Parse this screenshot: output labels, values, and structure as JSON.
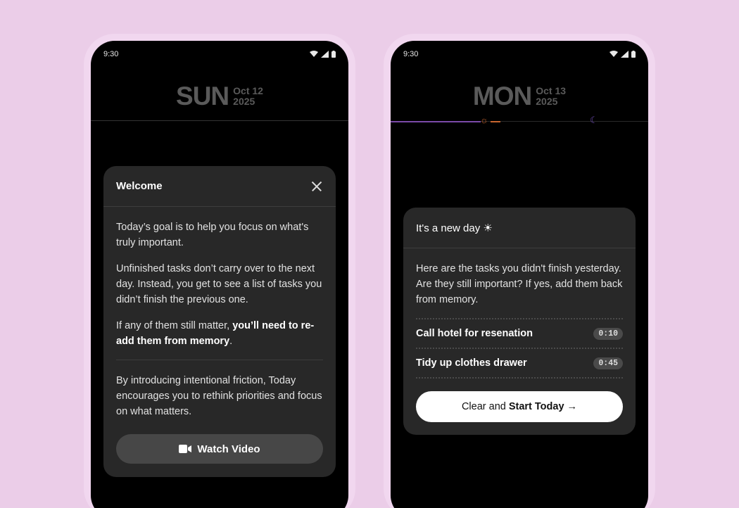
{
  "left_phone": {
    "status_time": "9:30",
    "day": "SUN",
    "date": "Oct 12",
    "year": "2025",
    "modal": {
      "title": "Welcome",
      "p1": "Today’s goal is to help you focus on what's truly important.",
      "p2": "Unfinished tasks don’t carry over to the next day. Instead, you get to see a list of tasks you didn’t finish the previous one.",
      "p3_prefix": "If any of them still matter, ",
      "p3_bold": "you’ll need to re-add them from memory",
      "p3_suffix": ".",
      "p4": "By introducing intentional friction, Today encourages you to rethink priorities and focus on what matters.",
      "button_label": "Watch Video"
    }
  },
  "right_phone": {
    "status_time": "9:30",
    "day": "MON",
    "date": "Oct 13",
    "year": "2025",
    "timeline": {
      "sun_icon": "☼",
      "moon_icon": "☾"
    },
    "card": {
      "title": "It's a new day ☀",
      "body": "Here are the tasks you didn't finish yesterday. Are they still important? If yes, add them back from memory.",
      "tasks": [
        {
          "name": "Call hotel for resenation",
          "time": "0:10"
        },
        {
          "name": "Tidy up clothes drawer",
          "time": "0:45"
        }
      ],
      "button_prefix": "Clear and ",
      "button_bold": "Start Today →"
    }
  }
}
